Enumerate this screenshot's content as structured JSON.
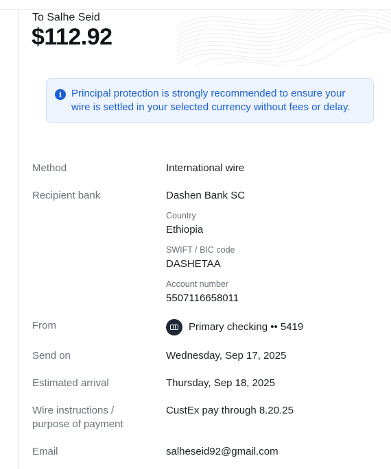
{
  "header": {
    "recipient_line": "To Salhe Seid",
    "amount": "$112.92"
  },
  "notice": {
    "icon": "info-icon",
    "text": "Principal protection is strongly recommended to ensure your wire is settled in your selected currency without fees or delay."
  },
  "details": {
    "method": {
      "label": "Method",
      "value": "International wire"
    },
    "recipient_bank": {
      "label": "Recipient bank",
      "value": "Dashen Bank SC",
      "country_label": "Country",
      "country_value": "Ethiopia",
      "swift_label": "SWIFT / BIC code",
      "swift_value": "DASHETAA",
      "account_label": "Account number",
      "account_value": "5507116658011"
    },
    "from": {
      "label": "From",
      "value": "Primary checking •• 5419",
      "icon": "bank-card-icon"
    },
    "send_on": {
      "label": "Send on",
      "value": "Wednesday, Sep 17, 2025"
    },
    "estimated_arrival": {
      "label": "Estimated arrival",
      "value": "Thursday, Sep 18, 2025"
    },
    "wire_instructions": {
      "label_line1": "Wire instructions /",
      "label_line2": "purpose of payment",
      "value": "CustEx pay through 8.20.25"
    },
    "email": {
      "label": "Email",
      "value": "salheseid92@gmail.com"
    }
  },
  "colors": {
    "accent": "#1a5fd6",
    "notice_bg": "#edf4fd",
    "label_gray": "#6b7078"
  }
}
